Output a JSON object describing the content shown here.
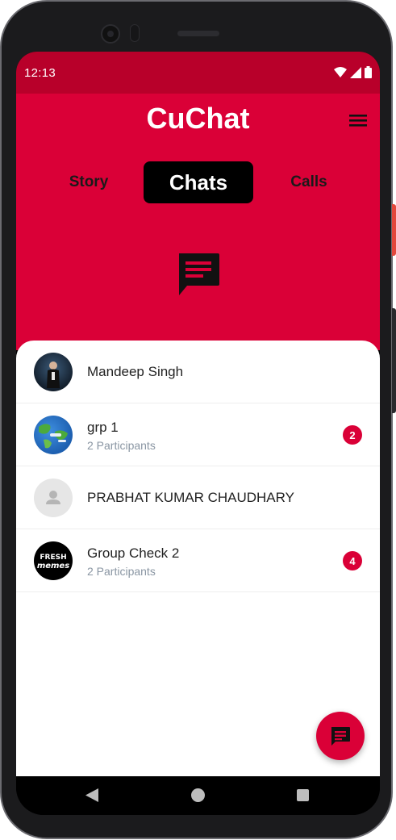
{
  "status_bar": {
    "time": "12:13"
  },
  "header": {
    "app_title": "CuChat",
    "tabs": [
      {
        "label": "Story",
        "active": false
      },
      {
        "label": "Chats",
        "active": true
      },
      {
        "label": "Calls",
        "active": false
      }
    ]
  },
  "chats": [
    {
      "name": "Mandeep Singh",
      "subtitle": "",
      "unread": "",
      "avatar": "photo-person"
    },
    {
      "name": "grp 1",
      "subtitle": "2 Participants",
      "unread": "2",
      "avatar": "globe-image"
    },
    {
      "name": "PRABHAT KUMAR CHAUDHARY",
      "subtitle": "",
      "unread": "",
      "avatar": "default-person-icon"
    },
    {
      "name": "Group Check 2",
      "subtitle": "2 Participants",
      "unread": "4",
      "avatar": "fresh-memes-logo"
    }
  ],
  "avatar_logo_text": "FRESH memes",
  "colors": {
    "primary": "#da0037",
    "status_bar": "#b8002a",
    "active_tab_bg": "#000000",
    "subtitle": "#8a96a3"
  },
  "fab_icon": "new-chat-icon"
}
